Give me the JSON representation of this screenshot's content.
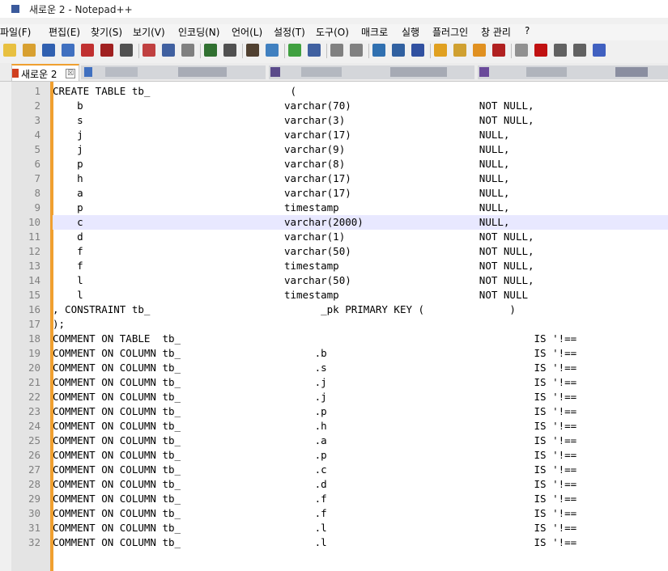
{
  "window": {
    "title": "새로운 2 - Notepad++"
  },
  "menu": [
    "파일(F)",
    "편집(E)",
    "찾기(S)",
    "보기(V)",
    "인코딩(N)",
    "언어(L)",
    "설정(T)",
    "도구(O)",
    "매크로",
    "실행",
    "플러그인",
    "창 관리",
    "?"
  ],
  "tab": {
    "label": "새로운 2",
    "close_glyph": "☒"
  },
  "editor": {
    "line_numbers": [
      "1",
      "2",
      "3",
      "4",
      "5",
      "6",
      "7",
      "8",
      "9",
      "10",
      "11",
      "12",
      "13",
      "14",
      "15",
      "16",
      "17",
      "18",
      "19",
      "20",
      "21",
      "22",
      "23",
      "24",
      "25",
      "26",
      "27",
      "28",
      "29",
      "30",
      "31",
      "32"
    ],
    "current_line": 10,
    "lines": [
      "CREATE TABLE tb_                       (",
      "    b                                 varchar(70)                     NOT NULL,",
      "    s                                 varchar(3)                      NOT NULL,",
      "    j                                 varchar(17)                     NULL,",
      "    j                                 varchar(9)                      NULL,",
      "    p                                 varchar(8)                      NULL,",
      "    h                                 varchar(17)                     NULL,",
      "    a                                 varchar(17)                     NULL,",
      "    p                                 timestamp                       NULL,",
      "    c                                 varchar(2000)                   NULL,",
      "    d                                 varchar(1)                      NOT NULL,",
      "    f                                 varchar(50)                     NOT NULL,",
      "    f                                 timestamp                       NOT NULL,",
      "    l                                 varchar(50)                     NOT NULL,",
      "    l                                 timestamp                       NOT NULL",
      ", CONSTRAINT tb_                            _pk PRIMARY KEY (              )",
      ");",
      "COMMENT ON TABLE  tb_                                                          IS '!==",
      "COMMENT ON COLUMN tb_                      .b                                  IS '!==",
      "COMMENT ON COLUMN tb_                      .s                                  IS '!==",
      "COMMENT ON COLUMN tb_                      .j                                  IS '!==",
      "COMMENT ON COLUMN tb_                      .j                                  IS '!==",
      "COMMENT ON COLUMN tb_                      .p                                  IS '!==",
      "COMMENT ON COLUMN tb_                      .h                                  IS '!==",
      "COMMENT ON COLUMN tb_                      .a                                  IS '!==",
      "COMMENT ON COLUMN tb_                      .p                                  IS '!==",
      "COMMENT ON COLUMN tb_                      .c                                  IS '!==",
      "COMMENT ON COLUMN tb_                      .d                                  IS '!==",
      "COMMENT ON COLUMN tb_                      .f                                  IS '!==",
      "COMMENT ON COLUMN tb_                      .f                                  IS '!==",
      "COMMENT ON COLUMN tb_                      .l                                  IS '!==",
      "COMMENT ON COLUMN tb_                      .l                                  IS '!=="
    ]
  },
  "colors": {
    "accent_orange": "#f0a030",
    "whitespace_dot": "#f0b070",
    "gutter": "#e4e4e4",
    "current_line_highlight": "#e8e8ff"
  },
  "toolbar_icons": [
    "new-file-icon",
    "open-icon",
    "save-icon",
    "save-all-icon",
    "close-icon",
    "close-all-icon",
    "print-icon",
    "cut-icon",
    "copy-icon",
    "paste-icon",
    "undo-icon",
    "redo-icon",
    "find-icon",
    "replace-icon",
    "zoom-in-icon",
    "zoom-out-icon",
    "sync-v-icon",
    "sync-h-icon",
    "wrap-icon",
    "show-all-chars-icon",
    "indent-guide-icon",
    "doc-map-icon",
    "function-list-icon",
    "folder-workspace-icon",
    "monitor-icon",
    "record-macro-icon",
    "stop-macro-icon",
    "play-macro-icon",
    "run-macro-icon",
    "save-macro-icon"
  ]
}
